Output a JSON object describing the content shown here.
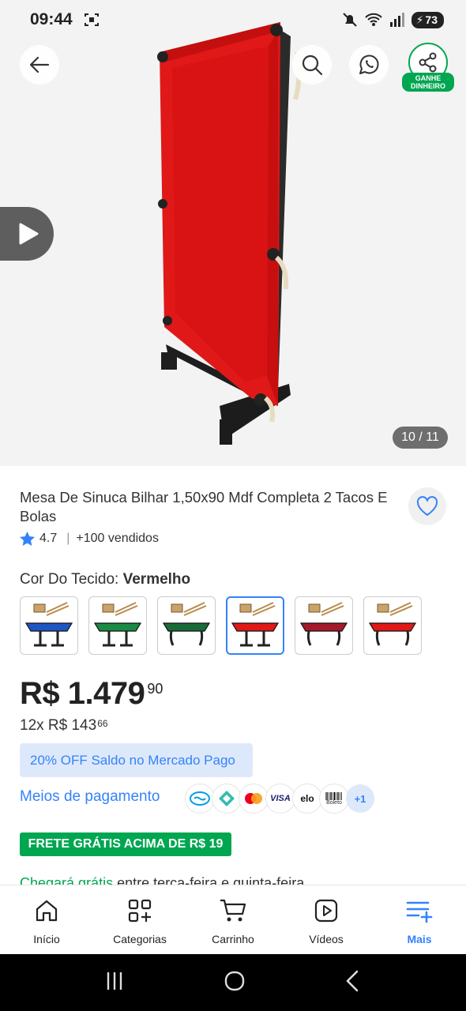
{
  "status_bar": {
    "time": "09:44",
    "battery": "73"
  },
  "gallery": {
    "counter": "10 / 11",
    "share_badge": "GANHE DINHEIRO"
  },
  "product": {
    "title": "Mesa De Sinuca Bilhar 1,50x90 Mdf Completa 2 Tacos E Bolas",
    "rating": "4.7",
    "sold": "+100 vendidos",
    "color_label": "Cor Do Tecido:",
    "color_value": "Vermelho",
    "swatches": [
      {
        "color": "#1f56c4",
        "legs": "straight"
      },
      {
        "color": "#1b8a45",
        "legs": "straight"
      },
      {
        "color": "#1a6b3a",
        "legs": "curved"
      },
      {
        "color": "#e01818",
        "legs": "straight",
        "selected": true
      },
      {
        "color": "#a51a2a",
        "legs": "curved"
      },
      {
        "color": "#e01818",
        "legs": "curved"
      }
    ],
    "price_main": "R$ 1.479",
    "price_cents": "90",
    "installments": "12x R$ 143",
    "installments_cents": "66",
    "promo": "20% OFF Saldo no Mercado Pago",
    "payment_link": "Meios de pagamento",
    "payment_icons": [
      "mercado-pago-icon",
      "pix-icon",
      "mastercard-icon",
      "visa-icon",
      "elo-icon",
      "boleto-icon"
    ],
    "payment_labels": {
      "visa": "VISA",
      "elo": "elo",
      "boleto": "Boleto",
      "more": "+1"
    },
    "shipping_badge": "FRETE GRÁTIS ACIMA DE R$ 19",
    "delivery_free": "Chegará grátis",
    "delivery_rest": " entre terça-feira e quinta-feira"
  },
  "bottom_nav": [
    {
      "label": "Início",
      "icon": "home-icon"
    },
    {
      "label": "Categorias",
      "icon": "categories-icon"
    },
    {
      "label": "Carrinho",
      "icon": "cart-icon"
    },
    {
      "label": "Vídeos",
      "icon": "video-icon"
    },
    {
      "label": "Mais",
      "icon": "menu-plus-icon",
      "active": true
    }
  ],
  "colors": {
    "accent": "#3483fa",
    "green": "#00a650",
    "felt": "#e01818"
  }
}
